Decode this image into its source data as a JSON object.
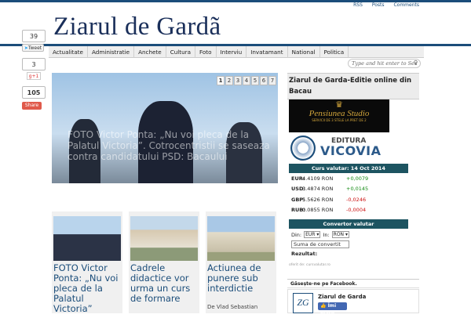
{
  "top_links": [
    "RSS",
    "Posts",
    "Comments"
  ],
  "site_title": "Ziarul de Gardã",
  "nav": [
    "Actualitate",
    "Administratie",
    "Anchete",
    "Cultura",
    "Foto",
    "Interviu",
    "Invatamant",
    "National",
    "Politica"
  ],
  "search": {
    "placeholder": "Type and hit enter to Sea"
  },
  "share": {
    "facebook_count": "39",
    "tweet_label": "Tweet",
    "twitter_count": "3",
    "gplus_label": "g+1",
    "total_count": "105",
    "share_label": "Share"
  },
  "slider": {
    "caption": "FOTO Victor Ponta: „Nu voi pleca de la Palatul Victoria”. Cotrocentristii se saseaza contra candidatului PSD: Bacaului",
    "pages": [
      "1",
      "2",
      "3",
      "4",
      "5",
      "6",
      "7"
    ],
    "active_page": "1"
  },
  "cards": [
    {
      "title": "FOTO Victor Ponta: „Nu voi pleca de la Palatul Victoria”",
      "excerpt": ""
    },
    {
      "title": "Cadrele didactice vor urma un curs de formare",
      "excerpt": ""
    },
    {
      "title": "Actiunea de punere sub interdictie",
      "excerpt": "De Vlad Sebastian"
    }
  ],
  "sidebar": {
    "edition_title": "Ziarul de Garda-Editie online din Bacau",
    "banner1": {
      "name": "Pensiunea Studio",
      "sub": "SERVICII DE 3 STELE LA PRET DE 2"
    },
    "banner2": {
      "label": "EDITURA",
      "name": "VICOVIA"
    },
    "fx": {
      "title": "Curs valutar: 14 Oct 2014",
      "rows": [
        {
          "code": "EUR:",
          "value": "4.4109 RON",
          "change": "+0,0079",
          "dir": "up"
        },
        {
          "code": "USD:",
          "value": "3.4874 RON",
          "change": "+0,0145",
          "dir": "up"
        },
        {
          "code": "GBP:",
          "value": "5.5626 RON",
          "change": "-0,0246",
          "dir": "down"
        },
        {
          "code": "RUB:",
          "value": "0.0855 RON",
          "change": "-0,0004",
          "dir": "down"
        }
      ],
      "converter_title": "Convertor valutar",
      "from_label": "Din:",
      "from_value": "EUR",
      "to_label": "In:",
      "to_value": "RON",
      "amount_placeholder": "Suma de convertit",
      "result_label": "Rezultat:",
      "credit": "oferit de: cursvalutar.ro"
    },
    "facebook": {
      "title": "Găsește-ne pe Facebook.",
      "page_name": "Ziarul de Garda",
      "like_label": "Îmi place",
      "logo_text": "ZG"
    }
  },
  "colors": {
    "brand": "#1b4d7a",
    "fx_header": "#1d5461",
    "up": "#138a13",
    "down": "#cc1111"
  }
}
